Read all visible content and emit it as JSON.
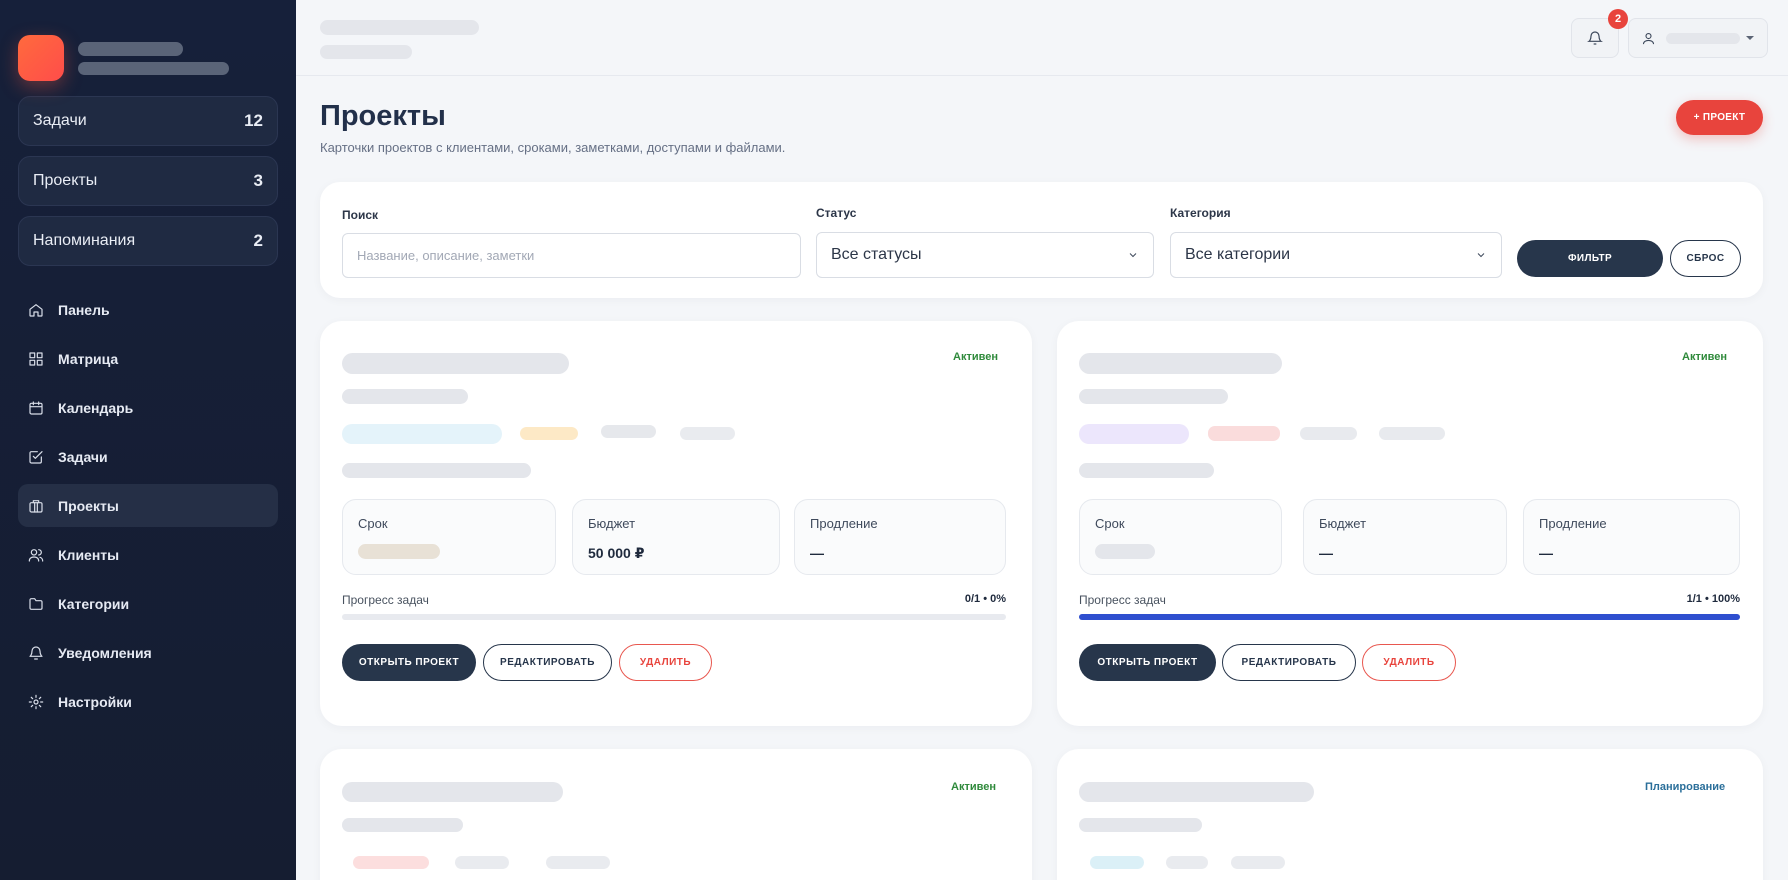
{
  "sidebar": {
    "stats": [
      {
        "label": "Задачи",
        "count": "12"
      },
      {
        "label": "Проекты",
        "count": "3"
      },
      {
        "label": "Напоминания",
        "count": "2"
      }
    ],
    "nav": [
      {
        "label": "Панель",
        "icon": "home-icon"
      },
      {
        "label": "Матрица",
        "icon": "grid-icon"
      },
      {
        "label": "Календарь",
        "icon": "calendar-icon"
      },
      {
        "label": "Задачи",
        "icon": "check-square-icon"
      },
      {
        "label": "Проекты",
        "icon": "briefcase-icon",
        "active": true
      },
      {
        "label": "Клиенты",
        "icon": "users-icon"
      },
      {
        "label": "Категории",
        "icon": "folder-icon"
      },
      {
        "label": "Уведомления",
        "icon": "bell-icon"
      },
      {
        "label": "Настройки",
        "icon": "gear-icon"
      }
    ]
  },
  "topbar": {
    "notifications_count": "2"
  },
  "page": {
    "title": "Проекты",
    "subtitle": "Карточки проектов с клиентами, сроками, заметками, доступами и файлами.",
    "add_button": "+ ПРОЕКТ"
  },
  "filter": {
    "search_label": "Поиск",
    "search_placeholder": "Название, описание, заметки",
    "status_label": "Статус",
    "status_value": "Все статусы",
    "category_label": "Категория",
    "category_value": "Все категории",
    "filter_button": "ФИЛЬТР",
    "reset_button": "СБРОС"
  },
  "projects": [
    {
      "status": "Активен",
      "metrics": {
        "deadline_label": "Срок",
        "budget_label": "Бюджет",
        "budget_value": "50 000 ₽",
        "renewal_label": "Продление",
        "renewal_value": "—"
      },
      "progress_label": "Прогресс задач",
      "progress_text": "0/1 • 0%",
      "progress": 0.0,
      "buttons": {
        "open": "ОТКРЫТЬ ПРОЕКТ",
        "edit": "РЕДАКТИРОВАТЬ",
        "delete": "УДАЛИТЬ"
      }
    },
    {
      "status": "Активен",
      "metrics": {
        "deadline_label": "Срок",
        "budget_label": "Бюджет",
        "budget_value": "—",
        "renewal_label": "Продление",
        "renewal_value": "—"
      },
      "progress_label": "Прогресс задач",
      "progress_text": "1/1 • 100%",
      "progress": 1.0,
      "buttons": {
        "open": "ОТКРЫТЬ ПРОЕКТ",
        "edit": "РЕДАКТИРОВАТЬ",
        "delete": "УДАЛИТЬ"
      }
    },
    {
      "status": "Активен"
    },
    {
      "status": "Планирование"
    }
  ],
  "colors": {
    "accent": "#e8443d",
    "dark": "#27364b",
    "progress": "#2f4fcf",
    "status_active": "#2f8a3b",
    "status_planning": "#2b6f9a"
  }
}
